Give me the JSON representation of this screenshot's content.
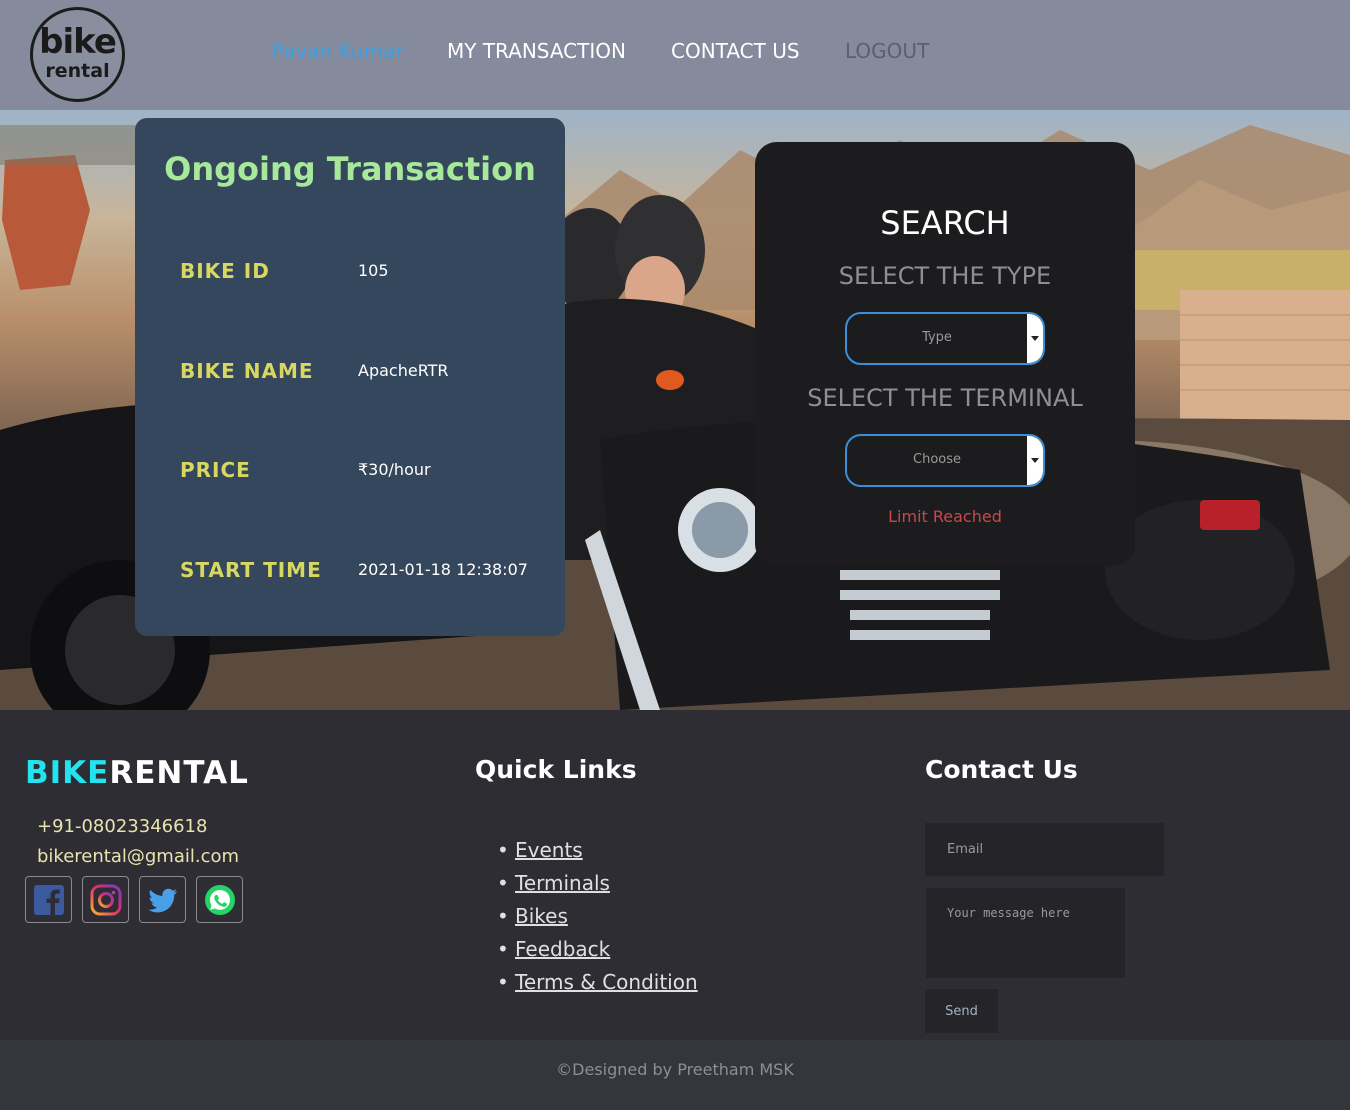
{
  "header": {
    "logo_line1": "bike",
    "logo_line2": "rental",
    "nav": {
      "user": "Pavan Kumar",
      "transactions": "MY TRANSACTION",
      "contact": "CONTACT US",
      "logout": "LOGOUT"
    }
  },
  "transaction": {
    "title": "Ongoing Transaction",
    "rows": [
      {
        "label": "BIKE ID",
        "value": "105"
      },
      {
        "label": "BIKE NAME",
        "value": "ApacheRTR"
      },
      {
        "label": "PRICE",
        "value": "₹30/hour"
      },
      {
        "label": "START TIME",
        "value": "2021-01-18 12:38:07"
      }
    ]
  },
  "search": {
    "title": "SEARCH",
    "type_label": "SELECT THE TYPE",
    "type_selected": "Type",
    "terminal_label": "SELECT THE TERMINAL",
    "terminal_selected": "Choose",
    "limit_message": "Limit Reached"
  },
  "footer": {
    "brand_part1": "BIKE",
    "brand_part2": "RENTAL",
    "phone": "+91-08023346618",
    "email": "bikerental@gmail.com",
    "social_icons": [
      "facebook-icon",
      "instagram-icon",
      "twitter-icon",
      "whatsapp-icon"
    ],
    "quick_links_title": "Quick Links",
    "quick_links": [
      "Events",
      "Terminals",
      "Bikes",
      "Feedback",
      "Terms & Condition"
    ],
    "contact_title": "Contact Us",
    "email_placeholder": "Email",
    "message_placeholder": "Your message here",
    "send_label": "Send",
    "copyright": "©Designed by Preetham MSK"
  },
  "colors": {
    "header_bg": "#858a9c",
    "card_bg": "#34475c",
    "card_title": "#a8e89a",
    "card_label": "#d8d860",
    "search_bg": "#1c1c1e",
    "select_border": "#3b8fd8",
    "limit_text": "#c8484a",
    "brand_accent": "#22e4ee",
    "footer_bg": "#2e2d34"
  }
}
